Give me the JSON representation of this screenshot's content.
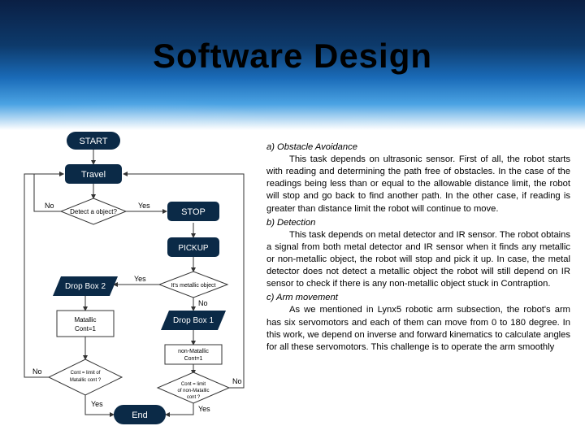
{
  "title": "Software Design",
  "flow": {
    "start": "START",
    "travel": "Travel",
    "detect": "Detect a object?",
    "stop": "STOP",
    "pickup": "PICKUP",
    "metallic": "It's metallic object",
    "dropbox1": "Drop Box 1",
    "dropbox2": "Drop Box 2",
    "mcount": "Matallic Cont=1",
    "nmcount": "non-Matallic Cont=1",
    "limit_m": "Cont = limit of Matallic cont ?",
    "limit_nm": "Cont = limit of non-Matallic cont ?",
    "end": "End",
    "yes": "Yes",
    "no": "No"
  },
  "sections": [
    {
      "title": "a) Obstacle Avoidance",
      "body": "This task depends on ultrasonic sensor. First of all, the robot starts with reading and determining the path free of obstacles. In the case of the readings being less than or equal to the allowable distance limit, the robot will stop and go back to find another path. In the other case, if reading is greater than distance limit the robot will continue to move."
    },
    {
      "title": "b) Detection",
      "body": "This task depends on metal detector and IR sensor. The robot obtains a signal from both metal detector and IR sensor when it finds any metallic or non-metallic object, the robot will stop and pick it up. In case, the metal detector does not detect a metallic object the robot will still depend on IR sensor to check if there is any non-metallic object stuck in Contraption."
    },
    {
      "title": "c) Arm movement",
      "body": "As we mentioned in Lynx5 robotic arm subsection, the robot's arm has six servomotors and each of them can move from 0 to 180 degree. In this work, we depend on inverse and forward kinematics to calculate angles for all these servomotors. This challenge is to operate the arm smoothly"
    }
  ]
}
